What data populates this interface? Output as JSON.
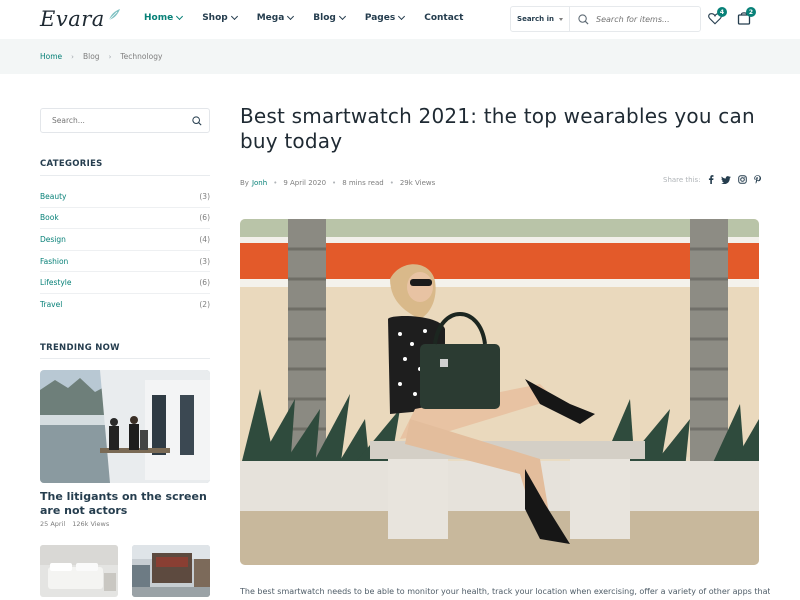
{
  "header": {
    "logo": "Evara",
    "nav": [
      {
        "label": "Home",
        "dropdown": true,
        "active": true
      },
      {
        "label": "Shop",
        "dropdown": true,
        "active": false
      },
      {
        "label": "Mega",
        "dropdown": true,
        "active": false
      },
      {
        "label": "Blog",
        "dropdown": true,
        "active": false
      },
      {
        "label": "Pages",
        "dropdown": true,
        "active": false
      },
      {
        "label": "Contact",
        "dropdown": false,
        "active": false
      }
    ],
    "search": {
      "category": "Search in",
      "placeholder": "Search for items..."
    },
    "wishlist_count": "4",
    "cart_count": "2"
  },
  "breadcrumb": [
    "Home",
    "Blog",
    "Technology"
  ],
  "sidebar": {
    "search_placeholder": "Search...",
    "categories_title": "CATEGORIES",
    "categories": [
      {
        "name": "Beauty",
        "count": "(3)"
      },
      {
        "name": "Book",
        "count": "(6)"
      },
      {
        "name": "Design",
        "count": "(4)"
      },
      {
        "name": "Fashion",
        "count": "(3)"
      },
      {
        "name": "Lifestyle",
        "count": "(6)"
      },
      {
        "name": "Travel",
        "count": "(2)"
      }
    ],
    "trending_title": "TRENDING NOW",
    "trending_post": {
      "title": "The litigants on the screen are not actors",
      "date": "25 April",
      "views": "126k Views"
    }
  },
  "post": {
    "title": "Best smartwatch 2021: the top wearables you can buy today",
    "by_label": "By",
    "author": "Jonh",
    "date": "9 April 2020",
    "read_time": "8 mins read",
    "views": "29k Views",
    "share_label": "Share this:",
    "excerpt": "The best smartwatch needs to be able to monitor your health, track your location when exercising, offer a variety of other apps that you"
  },
  "colors": {
    "brand": "#088178",
    "heading": "#253D4E",
    "muted": "#7e7e7e",
    "breadcrumb_bg": "#f3f6f6"
  }
}
